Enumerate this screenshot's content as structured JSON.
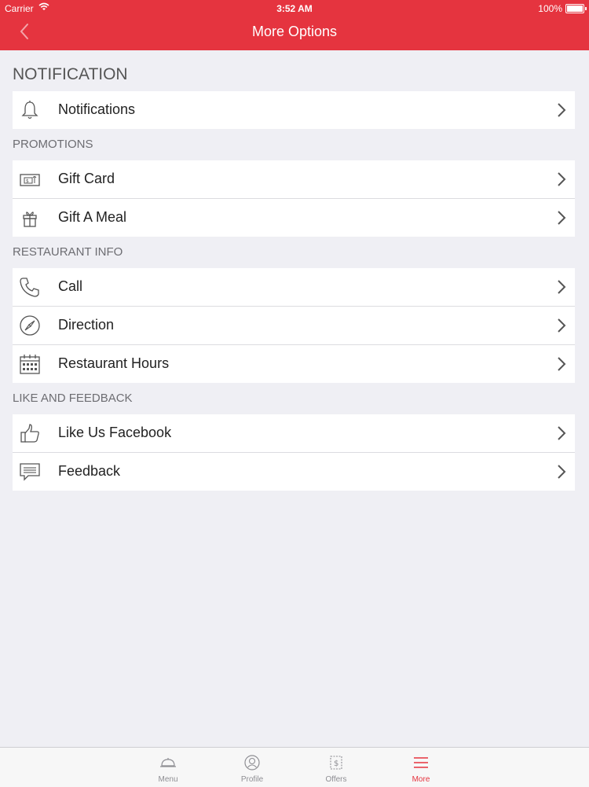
{
  "status_bar": {
    "carrier": "Carrier",
    "time": "3:52 AM",
    "battery": "100%"
  },
  "nav": {
    "title": "More Options"
  },
  "sections": {
    "notification": {
      "title": "NOTIFICATION",
      "items": [
        "Notifications"
      ]
    },
    "promotions": {
      "title": "PROMOTIONS",
      "items": [
        "Gift Card",
        "Gift A Meal"
      ]
    },
    "restaurant_info": {
      "title": "RESTAURANT INFO",
      "items": [
        "Call",
        "Direction",
        "Restaurant Hours"
      ]
    },
    "like_feedback": {
      "title": "LIKE AND FEEDBACK",
      "items": [
        "Like Us Facebook",
        "Feedback"
      ]
    }
  },
  "tabs": [
    {
      "label": "Menu",
      "icon": "cloche-icon"
    },
    {
      "label": "Profile",
      "icon": "profile-icon"
    },
    {
      "label": "Offers",
      "icon": "offers-icon"
    },
    {
      "label": "More",
      "icon": "hamburger-icon",
      "active": true
    }
  ],
  "colors": {
    "accent": "#e5343f",
    "background": "#efeff4"
  }
}
